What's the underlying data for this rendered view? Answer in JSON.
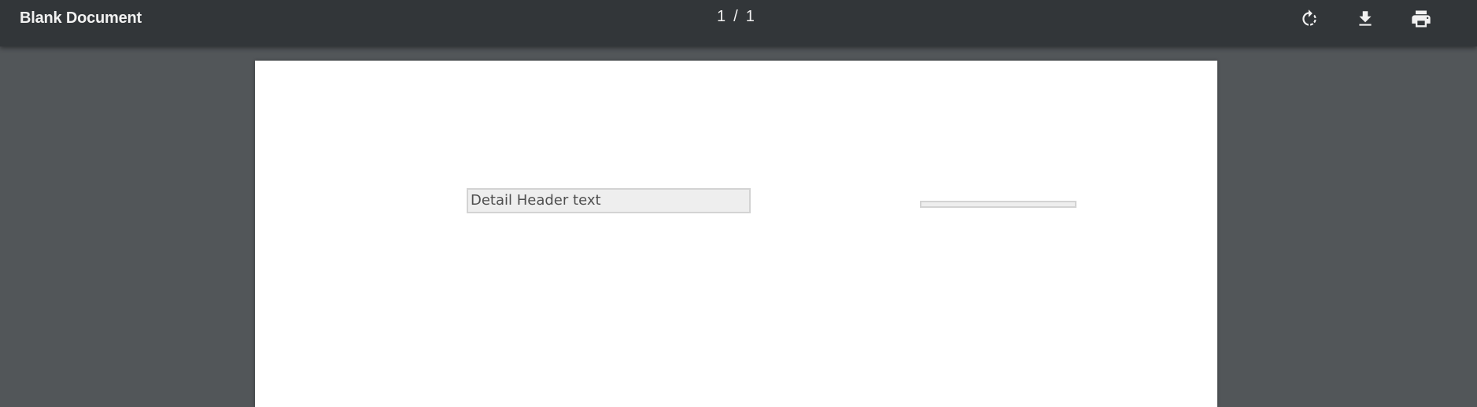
{
  "toolbar": {
    "title": "Blank Document",
    "page_current": "1",
    "page_separator": "/",
    "page_total": "1",
    "buttons": [
      {
        "name": "rotate",
        "icon": "rotate-icon"
      },
      {
        "name": "download",
        "icon": "download-icon"
      },
      {
        "name": "print",
        "icon": "print-icon"
      }
    ]
  },
  "document": {
    "fields": {
      "detail_header": "Detail Header text",
      "empty_field": ""
    }
  },
  "colors": {
    "toolbar_bg": "#323639",
    "viewer_bg": "#525659",
    "page_bg": "#ffffff",
    "field_bg": "#eeeeee",
    "field_border": "#d3d3d3"
  }
}
